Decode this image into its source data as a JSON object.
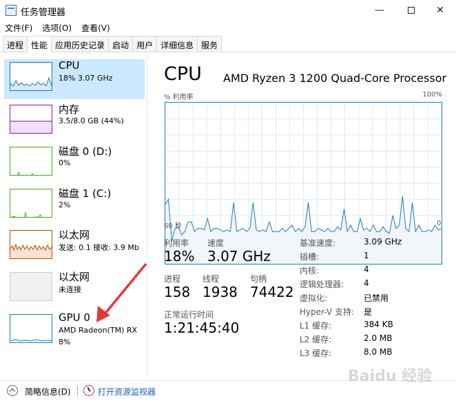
{
  "window": {
    "title": "任务管理器",
    "min_glyph": "—",
    "close_glyph": "✕"
  },
  "menu": [
    {
      "label": "文件(F)"
    },
    {
      "label": "选项(O)"
    },
    {
      "label": "查看(V)"
    }
  ],
  "tabs": [
    {
      "label": "进程",
      "active": false
    },
    {
      "label": "性能",
      "active": true
    },
    {
      "label": "应用历史记录",
      "active": false
    },
    {
      "label": "启动",
      "active": false
    },
    {
      "label": "用户",
      "active": false
    },
    {
      "label": "详细信息",
      "active": false
    },
    {
      "label": "服务",
      "active": false
    }
  ],
  "devices": [
    {
      "id": "cpu",
      "name": "CPU",
      "sub": "18% 3.07 GHz",
      "sub2": "",
      "selected": true,
      "color": "#117dbb"
    },
    {
      "id": "memory",
      "name": "内存",
      "sub": "3.5/8.0 GB (44%)",
      "sub2": "",
      "selected": false,
      "color": "#8b12ae"
    },
    {
      "id": "disk0",
      "name": "磁盘 0 (D:)",
      "sub": "0%",
      "sub2": "",
      "selected": false,
      "color": "#4da60c"
    },
    {
      "id": "disk1",
      "name": "磁盘 1 (C:)",
      "sub": "2%",
      "sub2": "",
      "selected": false,
      "color": "#4da60c"
    },
    {
      "id": "ethernet1",
      "name": "以太网",
      "sub": "发送: 0.1  接收: 3.9 Mb",
      "sub2": "",
      "selected": false,
      "color": "#a74f01"
    },
    {
      "id": "ethernet2",
      "name": "以太网",
      "sub": "未连接",
      "sub2": "",
      "selected": false,
      "color": "#aaaaaa"
    },
    {
      "id": "gpu0",
      "name": "GPU 0",
      "sub": "AMD Radeon(TM) RX",
      "sub2": "8%",
      "selected": false,
      "color": "#117dbb"
    }
  ],
  "main": {
    "title": "CPU",
    "model": "AMD Ryzen 3 1200 Quad-Core Processor",
    "util_label": "% 利用率",
    "util_max": "100%",
    "axis_left": "60 秒",
    "axis_right": "0",
    "stats": [
      {
        "label": "利用率",
        "value": "18%"
      },
      {
        "label": "速度",
        "value": "3.07 GHz"
      },
      {
        "label": "进程",
        "value": "158"
      },
      {
        "label": "线程",
        "value": "1938"
      },
      {
        "label": "句柄",
        "value": "74422"
      },
      {
        "label": "正常运行时间",
        "value": "1:21:45:40"
      }
    ],
    "specs": [
      {
        "k": "基准速度:",
        "v": "3.09 GHz"
      },
      {
        "k": "插槽:",
        "v": "1"
      },
      {
        "k": "内核:",
        "v": "4"
      },
      {
        "k": "逻辑处理器:",
        "v": "4"
      },
      {
        "k": "虚拟化:",
        "v": "已禁用"
      },
      {
        "k": "Hyper-V 支持:",
        "v": "是"
      },
      {
        "k": "L1 缓存:",
        "v": "384 KB"
      },
      {
        "k": "L2 缓存:",
        "v": "2.0 MB"
      },
      {
        "k": "L3 缓存:",
        "v": "8.0 MB"
      }
    ]
  },
  "footer": {
    "fewer_details": "简略信息(D)",
    "open_monitor": "打开资源监视器"
  },
  "watermark": "Baidu 经验",
  "cpu_history": [
    63,
    60,
    86,
    78,
    77,
    82,
    80,
    74,
    74,
    80,
    78,
    78,
    79,
    72,
    80,
    78,
    78,
    79,
    80,
    79,
    80,
    62,
    80,
    79,
    78,
    80,
    78,
    62,
    79,
    80,
    79,
    80,
    74,
    80,
    80,
    80,
    78,
    80,
    78,
    76,
    80,
    78,
    80,
    77,
    62,
    80,
    80,
    78,
    79,
    80,
    78,
    80,
    80,
    77,
    79,
    66,
    80,
    76,
    80,
    80,
    72,
    79,
    78,
    80,
    76,
    80,
    80,
    77,
    80,
    81,
    70,
    78,
    76,
    58,
    78,
    80,
    62,
    80,
    76,
    80,
    80,
    79,
    80,
    76,
    79,
    78
  ]
}
